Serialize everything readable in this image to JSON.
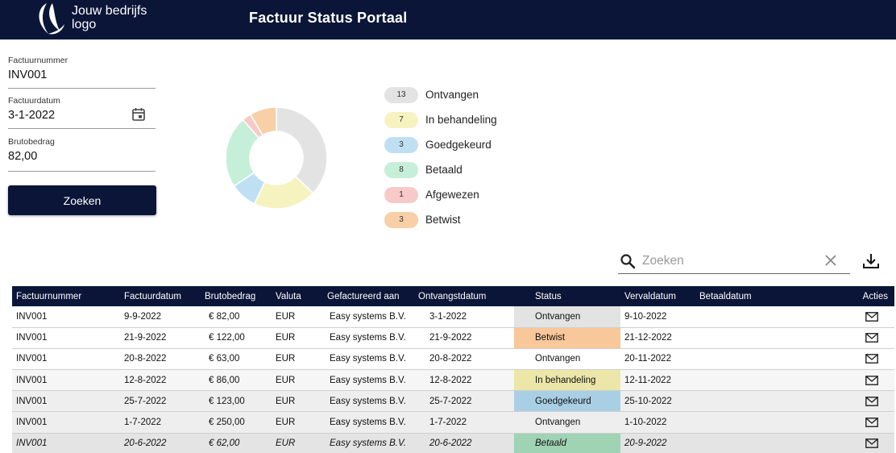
{
  "header": {
    "logo_text_line1": "Jouw bedrijfs",
    "logo_text_line2": "logo",
    "title": "Factuur Status Portaal"
  },
  "form": {
    "invoice_number_label": "Factuurnummer",
    "invoice_number_value": "INV001",
    "invoice_date_label": "Factuurdatum",
    "invoice_date_value": "3-1-2022",
    "gross_amount_label": "Brutobedrag",
    "gross_amount_value": "82,00",
    "search_button_label": "Zoeken"
  },
  "status_summary": [
    {
      "count": "13",
      "label": "Ontvangen",
      "color": "#e3e3e3"
    },
    {
      "count": "7",
      "label": "In behandeling",
      "color": "#f6f3c0"
    },
    {
      "count": "3",
      "label": "Goedgekeurd",
      "color": "#bfe0f3"
    },
    {
      "count": "8",
      "label": "Betaald",
      "color": "#c5efd8"
    },
    {
      "count": "1",
      "label": "Afgewezen",
      "color": "#f7c9c9"
    },
    {
      "count": "3",
      "label": "Betwist",
      "color": "#f8cfa6"
    }
  ],
  "chart_data": {
    "type": "pie",
    "donut": true,
    "categories": [
      "Ontvangen",
      "In behandeling",
      "Goedgekeurd",
      "Betaald",
      "Afgewezen",
      "Betwist"
    ],
    "values": [
      13,
      7,
      3,
      8,
      1,
      3
    ],
    "colors": [
      "#e3e3e3",
      "#f6f3c0",
      "#bfe0f3",
      "#c5efd8",
      "#f7c9c9",
      "#f8cfa6"
    ],
    "legend": "right"
  },
  "table_search": {
    "placeholder": "Zoeken"
  },
  "table": {
    "columns": [
      "Factuurnummer",
      "Factuurdatum",
      "Brutobedrag",
      "Valuta",
      "Gefactureerd aan",
      "Ontvangstdatum",
      "Status",
      "Vervaldatum",
      "Betaaldatum",
      "Acties"
    ],
    "rows": [
      {
        "nummer": "INV001",
        "datum": "9-9-2022",
        "bedrag": "€ 82,00",
        "valuta": "EUR",
        "aan": "Easy systems B.V.",
        "ontvangst": "3-1-2022",
        "status": "Ontvangen",
        "status_color": "#e3e3e3",
        "verval": "9-10-2022",
        "betaal": ""
      },
      {
        "nummer": "INV001",
        "datum": "21-9-2022",
        "bedrag": "€ 122,00",
        "valuta": "EUR",
        "aan": "Easy systems B.V.",
        "ontvangst": "21-9-2022",
        "status": "Betwist",
        "status_color": "#f8c79a",
        "verval": "21-12-2022",
        "betaal": ""
      },
      {
        "nummer": "INV001",
        "datum": "20-8-2022",
        "bedrag": "€ 63,00",
        "valuta": "EUR",
        "aan": "Easy systems B.V.",
        "ontvangst": "20-8-2022",
        "status": "Ontvangen",
        "status_color": "",
        "verval": "20-11-2022",
        "betaal": ""
      },
      {
        "nummer": "INV001",
        "datum": "12-8-2022",
        "bedrag": "€ 86,00",
        "valuta": "EUR",
        "aan": "Easy systems B.V.",
        "ontvangst": "12-8-2022",
        "status": "In behandeling",
        "status_color": "#ece7a8",
        "verval": "12-11-2022",
        "betaal": ""
      },
      {
        "nummer": "INV001",
        "datum": "25-7-2022",
        "bedrag": "€ 123,00",
        "valuta": "EUR",
        "aan": "Easy systems B.V.",
        "ontvangst": "25-7-2022",
        "status": "Goedgekeurd",
        "status_color": "#a9cfe4",
        "verval": "25-10-2022",
        "betaal": ""
      },
      {
        "nummer": "INV001",
        "datum": "1-7-2022",
        "bedrag": "€ 250,00",
        "valuta": "EUR",
        "aan": "Easy systems B.V.",
        "ontvangst": "1-7-2022",
        "status": "Ontvangen",
        "status_color": "",
        "verval": "1-10-2022",
        "betaal": ""
      },
      {
        "nummer": "INV001",
        "datum": "20-6-2022",
        "bedrag": "€ 62,00",
        "valuta": "EUR",
        "aan": "Easy systems B.V.",
        "ontvangst": "20-6-2022",
        "status": "Betaald",
        "status_color": "#9fd3b4",
        "verval": "20-9-2022",
        "betaal": ""
      }
    ]
  },
  "icons": {
    "logo": "swoosh-logo-icon",
    "calendar": "calendar-icon",
    "search": "search-icon",
    "clear": "close-icon",
    "download": "download-icon",
    "row_action": "mail-icon"
  },
  "colors": {
    "brand_navy": "#0b1538"
  }
}
